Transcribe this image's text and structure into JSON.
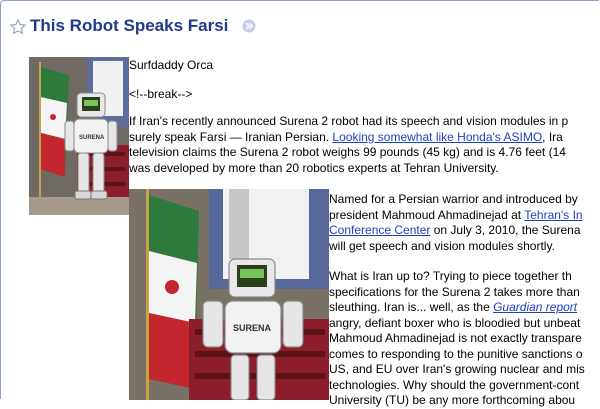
{
  "post": {
    "title": "This Robot Speaks Farsi",
    "author": "Surfdaddy Orca",
    "break_marker": "<!--break-->",
    "p1": {
      "line1": "If Iran's recently announced Surena 2 robot had its speech and vision modules in p",
      "line2_a": "surely speak Farsi — Iranian Persian.  ",
      "line2_link": "Looking somewhat like Honda's ASIMO",
      "line2_b": ", Ira",
      "line3": "television claims the Surena 2 robot weighs 99 pounds (45 kg) and is 4.76 feet (14",
      "line4": "was developed by more than 20 robotics experts at Tehran University."
    },
    "p2": {
      "line1": "Named for a Persian warrior and introduced by",
      "line2_a": "president Mahmoud Ahmadinejad at ",
      "line2_link": "Tehran's In",
      "line3_link": "Conference Center",
      "line3_b": " on July 3, 2010, the Surena",
      "line4": "will get speech and vision modules shortly."
    },
    "p3": {
      "line1": "What is Iran up to?  Trying to piece together th",
      "line2": "specifications for the Surena 2 takes more than",
      "line3_a": "sleuthing. Iran is... well, as the ",
      "line3_link": "Guardian report",
      "line4": "angry, defiant boxer who is bloodied but unbeat",
      "line5": "Mahmoud Ahmadinejad is not exactly transpare",
      "line6": "comes to responding to the punitive sanctions o",
      "line7": "US, and EU over Iran's growing nuclear and mis",
      "line8": "technologies. Why should the government-cont",
      "line9": "University (TU) be any more forthcoming abou"
    },
    "icons": {
      "star": "star-outline-icon",
      "more": "double-chevron-right-icon"
    },
    "colors": {
      "title": "#1f3a8a",
      "link": "#1f3fbf",
      "frame_border": "#8fa2c8"
    }
  }
}
